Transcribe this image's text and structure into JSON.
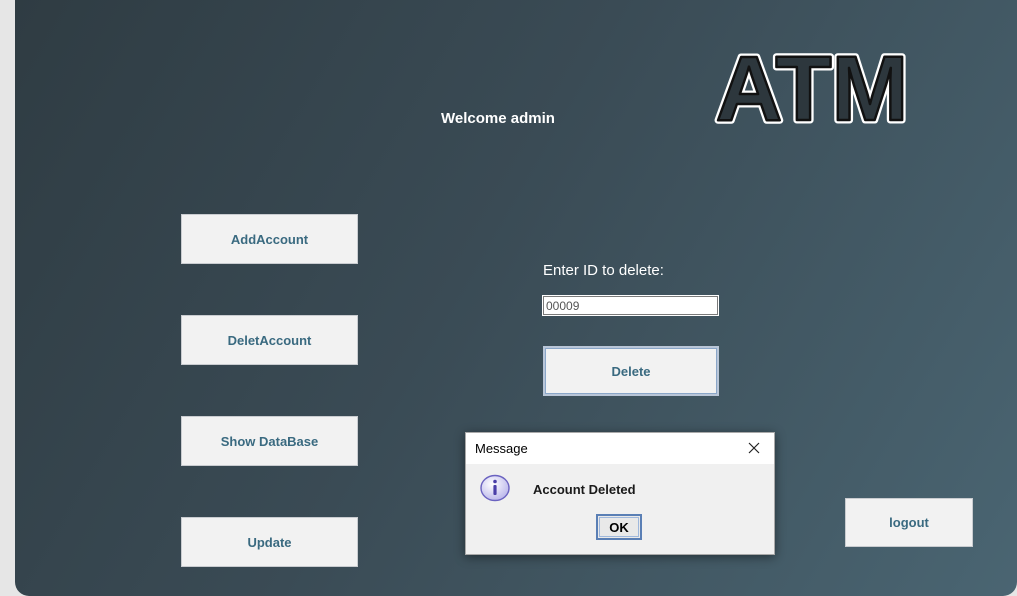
{
  "header": {
    "welcome_text": "Welcome admin",
    "logo_text": "ATM"
  },
  "sidebar": {
    "buttons": [
      {
        "label": "AddAccount"
      },
      {
        "label": "DeletAccount"
      },
      {
        "label": "Show DataBase"
      },
      {
        "label": "Update"
      }
    ]
  },
  "delete_form": {
    "prompt": "Enter ID to delete:",
    "id_value": "00009",
    "delete_label": "Delete"
  },
  "logout_label": "logout",
  "dialog": {
    "title": "Message",
    "message": "Account Deleted",
    "ok_label": "OK",
    "icon": "info-icon"
  },
  "colors": {
    "panel_dark": "#2f3c43",
    "panel_light": "#4a6572",
    "button_text": "#3a6a80",
    "button_bg": "#f2f2f2"
  }
}
